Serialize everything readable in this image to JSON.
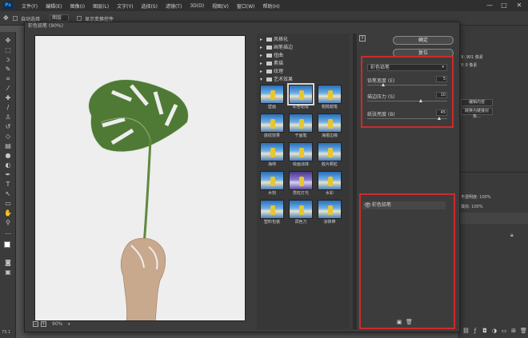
{
  "app": {
    "logo": "Ps",
    "menu": [
      "文件(F)",
      "编辑(E)",
      "图像(I)",
      "图层(L)",
      "文字(Y)",
      "选择(S)",
      "滤镜(T)",
      "3D(D)",
      "视图(V)",
      "窗口(W)",
      "帮助(H)"
    ],
    "window_controls": [
      "—",
      "□",
      "✕"
    ]
  },
  "options_bar": {
    "move_label": "自动选择",
    "layer_label": "图层",
    "transform_label": "显示变换控件"
  },
  "right_panels": {
    "info_x": "X: 901 像素",
    "info_y": "Y: 0 像素",
    "btn_edit": "编辑内容",
    "btn_convert": "转换为链接对象...",
    "opacity_label": "不透明度: 100%",
    "fill_label": "填充: 100%"
  },
  "dialog": {
    "title": "彩色铅笔 (90%)",
    "zoom": "90%",
    "ok_label": "确定",
    "reset_label": "复位",
    "filter_select": "彩色铅笔",
    "params": [
      {
        "label": "铅笔宽度 (E)",
        "value": "5",
        "fraction": 0.2
      },
      {
        "label": "描边压力 (S)",
        "value": "10",
        "fraction": 0.67
      },
      {
        "label": "纸张亮度 (B)",
        "value": "45",
        "fraction": 0.9
      }
    ],
    "effect_layer": "彩色铅笔",
    "categories": [
      {
        "label": "风格化",
        "expanded": false
      },
      {
        "label": "画笔描边",
        "expanded": false
      },
      {
        "label": "扭曲",
        "expanded": false
      },
      {
        "label": "素描",
        "expanded": false
      },
      {
        "label": "纹理",
        "expanded": false
      },
      {
        "label": "艺术效果",
        "expanded": true
      }
    ],
    "thumbs": [
      {
        "label": "壁画",
        "selected": false
      },
      {
        "label": "彩色铅笔",
        "selected": true
      },
      {
        "label": "粗糙蜡笔",
        "selected": false
      },
      {
        "label": "底纹效果",
        "selected": false
      },
      {
        "label": "干画笔",
        "selected": false
      },
      {
        "label": "海报边缘",
        "selected": false
      },
      {
        "label": "海绵",
        "selected": false
      },
      {
        "label": "绘画涂抹",
        "selected": false
      },
      {
        "label": "胶片颗粒",
        "selected": false
      },
      {
        "label": "木刻",
        "selected": false
      },
      {
        "label": "霓虹灯光",
        "selected": false
      },
      {
        "label": "水彩",
        "selected": false
      },
      {
        "label": "塑料包装",
        "selected": false
      },
      {
        "label": "调色刀",
        "selected": false
      },
      {
        "label": "涂抹棒",
        "selected": false
      }
    ]
  },
  "status": {
    "zoom_left": "73.1"
  },
  "colors": {
    "highlight": "#d02a2a",
    "canvas": "#eeeeee",
    "leaf": "#4f7a35"
  }
}
